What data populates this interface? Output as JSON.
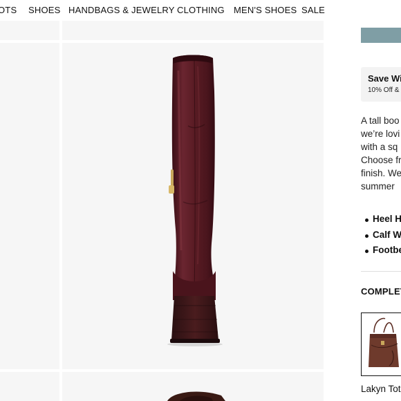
{
  "nav": {
    "items": [
      "OTS",
      "SHOES",
      "HANDBAGS & JEWELRY",
      "CLOTHING",
      "MEN'S SHOES",
      "SALE"
    ]
  },
  "product": {
    "image_icon": "tall-burgundy-boot-back-view",
    "boot_color": "#5a1c24"
  },
  "promo": {
    "title": "Save Wi",
    "subtitle": "10% Off & I"
  },
  "description": {
    "lines": [
      "A tall boo",
      "we’re lovi",
      "with a sq",
      "Choose fr",
      "finish. We",
      "summer"
    ]
  },
  "features": [
    "Heel H",
    "Calf W",
    "Footbe"
  ],
  "complete_look": {
    "heading": "COMPLET",
    "item_name": "Lakyn Tot",
    "item_icon": "burgundy-tote-bag"
  },
  "colors": {
    "accent_button": "#7f9ea5",
    "tile_bg": "#f6f6f6"
  }
}
